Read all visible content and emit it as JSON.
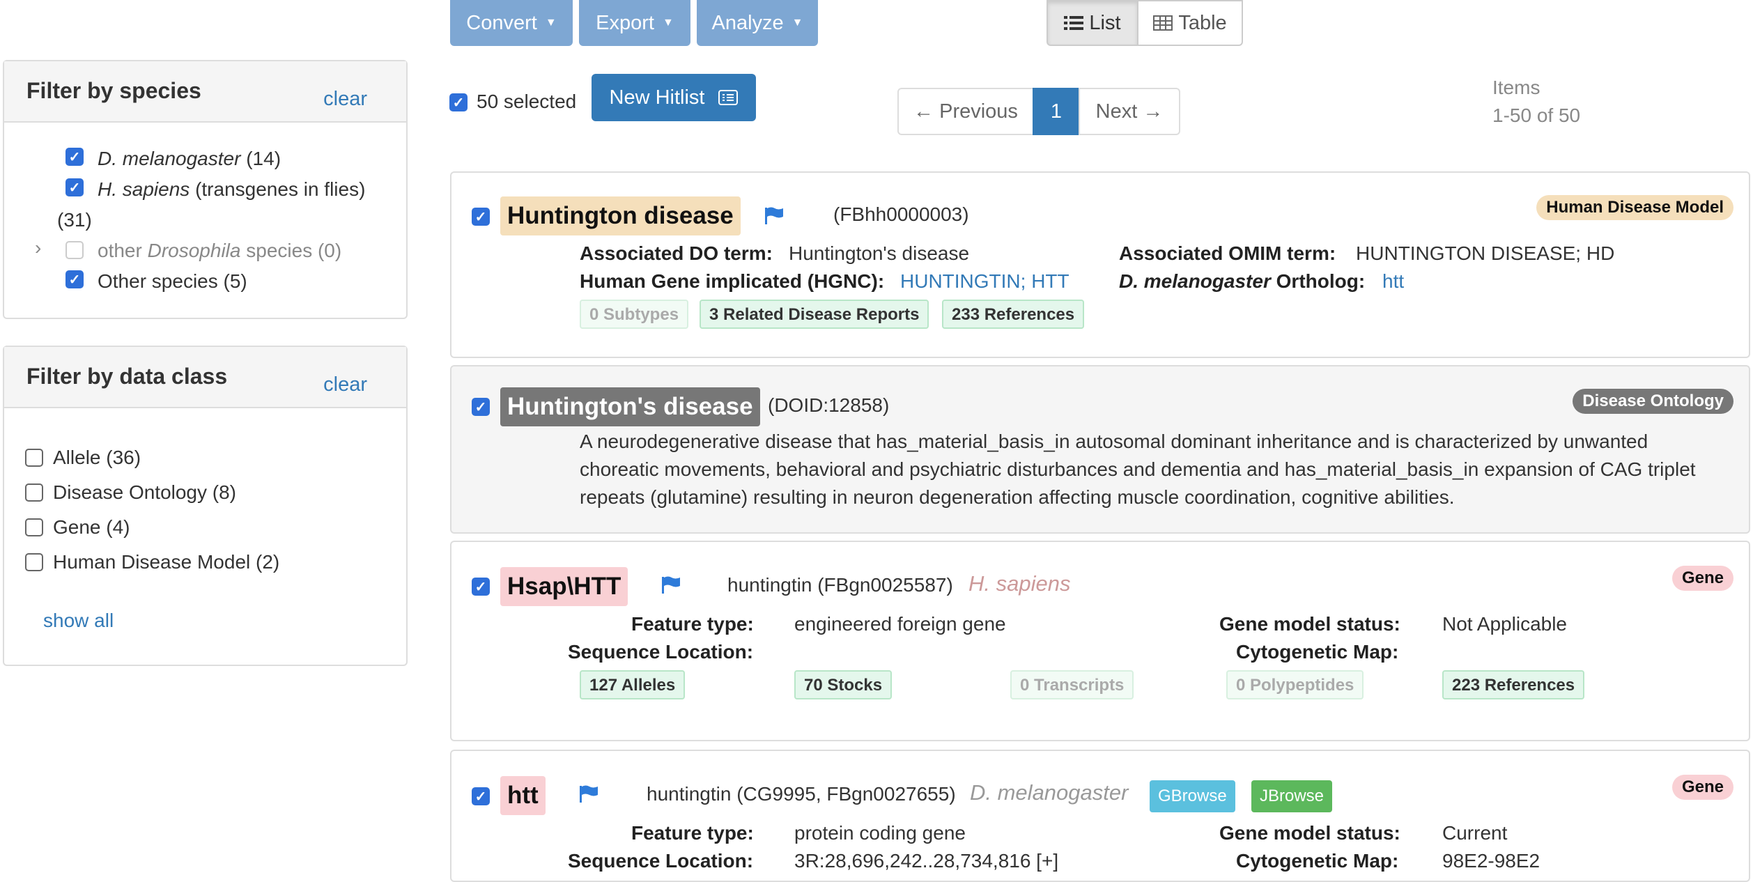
{
  "toolbar": {
    "convert": "Convert",
    "export": "Export",
    "analyze": "Analyze",
    "view_list": "List",
    "view_table": "Table"
  },
  "selection": {
    "selected_label": "50 selected",
    "new_hitlist": "New Hitlist"
  },
  "pagination": {
    "previous": "← Previous",
    "current": "1",
    "next": "Next →",
    "items_label": "Items",
    "items_range": "1-50 of 50"
  },
  "species_filter": {
    "title": "Filter by species",
    "clear": "clear",
    "items": [
      {
        "name": "D. melanogaster",
        "count": "(14)",
        "checked": true
      },
      {
        "name": "H. sapiens",
        "suffix": "(transgenes in flies)",
        "count": "(31)",
        "checked": true
      },
      {
        "prefix": "other",
        "name": "Drosophila",
        "suffix": "species (0)",
        "checked": false
      },
      {
        "name": "Other species (5)",
        "checked": true
      }
    ]
  },
  "class_filter": {
    "title": "Filter by data class",
    "clear": "clear",
    "items": [
      {
        "label": "Allele (36)"
      },
      {
        "label": "Disease Ontology (8)"
      },
      {
        "label": "Gene (4)"
      },
      {
        "label": "Human Disease Model (2)"
      }
    ],
    "show_all": "show all"
  },
  "results": [
    {
      "title": "Huntington disease",
      "id": "(FBhh0000003)",
      "badge": "Human Disease Model",
      "do_term_label": "Associated DO term:",
      "do_term": "Huntington's disease",
      "omim_label": "Associated OMIM term:",
      "omim": "HUNTINGTON DISEASE; HD",
      "hgnc_label": "Human Gene implicated (HGNC):",
      "hgnc": "HUNTINGTIN; HTT",
      "ortholog_label_sp": "D. melanogaster",
      "ortholog_label": "Ortholog:",
      "ortholog": "htt",
      "pills": [
        "0 Subtypes",
        "3 Related Disease Reports",
        "233 References"
      ]
    },
    {
      "title": "Huntington's disease",
      "id": "(DOID:12858)",
      "badge": "Disease Ontology",
      "desc1": "A neurodegenerative disease that has_material_basis_in autosomal dominant inheritance and is characterized by unwanted",
      "desc2": "choreatic movements, behavioral and psychiatric disturbances and dementia and has_material_basis_in expansion of CAG triplet",
      "desc3": "repeats (glutamine) resulting in neuron degeneration affecting muscle coordination, cognitive abilities."
    },
    {
      "title": "Hsap\\HTT",
      "symbol_desc": "huntingtin (FBgn0025587)",
      "species": "H. sapiens",
      "badge": "Gene",
      "feature_type_label": "Feature type:",
      "feature_type": "engineered foreign gene",
      "gms_label": "Gene model status:",
      "gms": "Not Applicable",
      "seqloc_label": "Sequence Location:",
      "seqloc": "",
      "cyto_label": "Cytogenetic Map:",
      "cyto": "",
      "pills": [
        "127 Alleles",
        "70 Stocks",
        "0 Transcripts",
        "0 Polypeptides",
        "223 References"
      ]
    },
    {
      "title": "htt",
      "symbol_desc": "huntingtin (CG9995, FBgn0027655)",
      "species": "D. melanogaster",
      "gbrowse": "GBrowse",
      "jbrowse": "JBrowse",
      "badge": "Gene",
      "feature_type_label": "Feature type:",
      "feature_type": "protein coding gene",
      "gms_label": "Gene model status:",
      "gms": "Current",
      "seqloc_label": "Sequence Location:",
      "seqloc": "3R:28,696,242..28,734,816 [+]",
      "cyto_label": "Cytogenetic Map:",
      "cyto": "98E2-98E2"
    }
  ],
  "colors": {
    "primary": "#337ab7",
    "toolbar_btn": "#7ea7d3",
    "hdm_tag": "#f5dfbb",
    "do_tag": "#777777",
    "gene_tag": "#f9d0d4",
    "check": "#2e6fd9"
  }
}
